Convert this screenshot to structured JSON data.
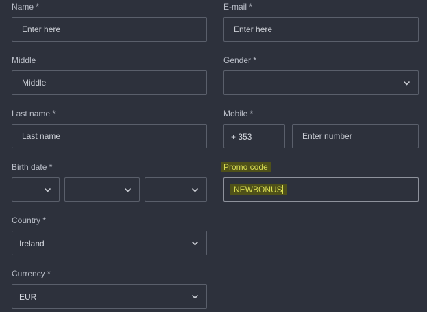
{
  "form": {
    "name": {
      "label": "Name *",
      "placeholder": "Enter here"
    },
    "email": {
      "label": "E-mail *",
      "placeholder": "Enter here"
    },
    "middle": {
      "label": "Middle",
      "placeholder": "Middle"
    },
    "gender": {
      "label": "Gender *",
      "value": ""
    },
    "last_name": {
      "label": "Last name *",
      "placeholder": "Last name"
    },
    "mobile": {
      "label": "Mobile *",
      "country_code": "+ 353",
      "placeholder": "Enter number"
    },
    "birth_date": {
      "label": "Birth date *",
      "day": "",
      "month": "",
      "year": ""
    },
    "promo": {
      "label": "Promo code",
      "value": "NEWBONUS"
    },
    "country": {
      "label": "Country *",
      "value": "Ireland"
    },
    "currency": {
      "label": "Currency *",
      "value": "EUR"
    }
  },
  "colors": {
    "background": "#2d313c",
    "border": "#5a5f6b",
    "highlight_bg": "#4f5119",
    "highlight_text": "#d8dc52"
  },
  "icons": {
    "dropdown": "chevron-down-icon"
  }
}
